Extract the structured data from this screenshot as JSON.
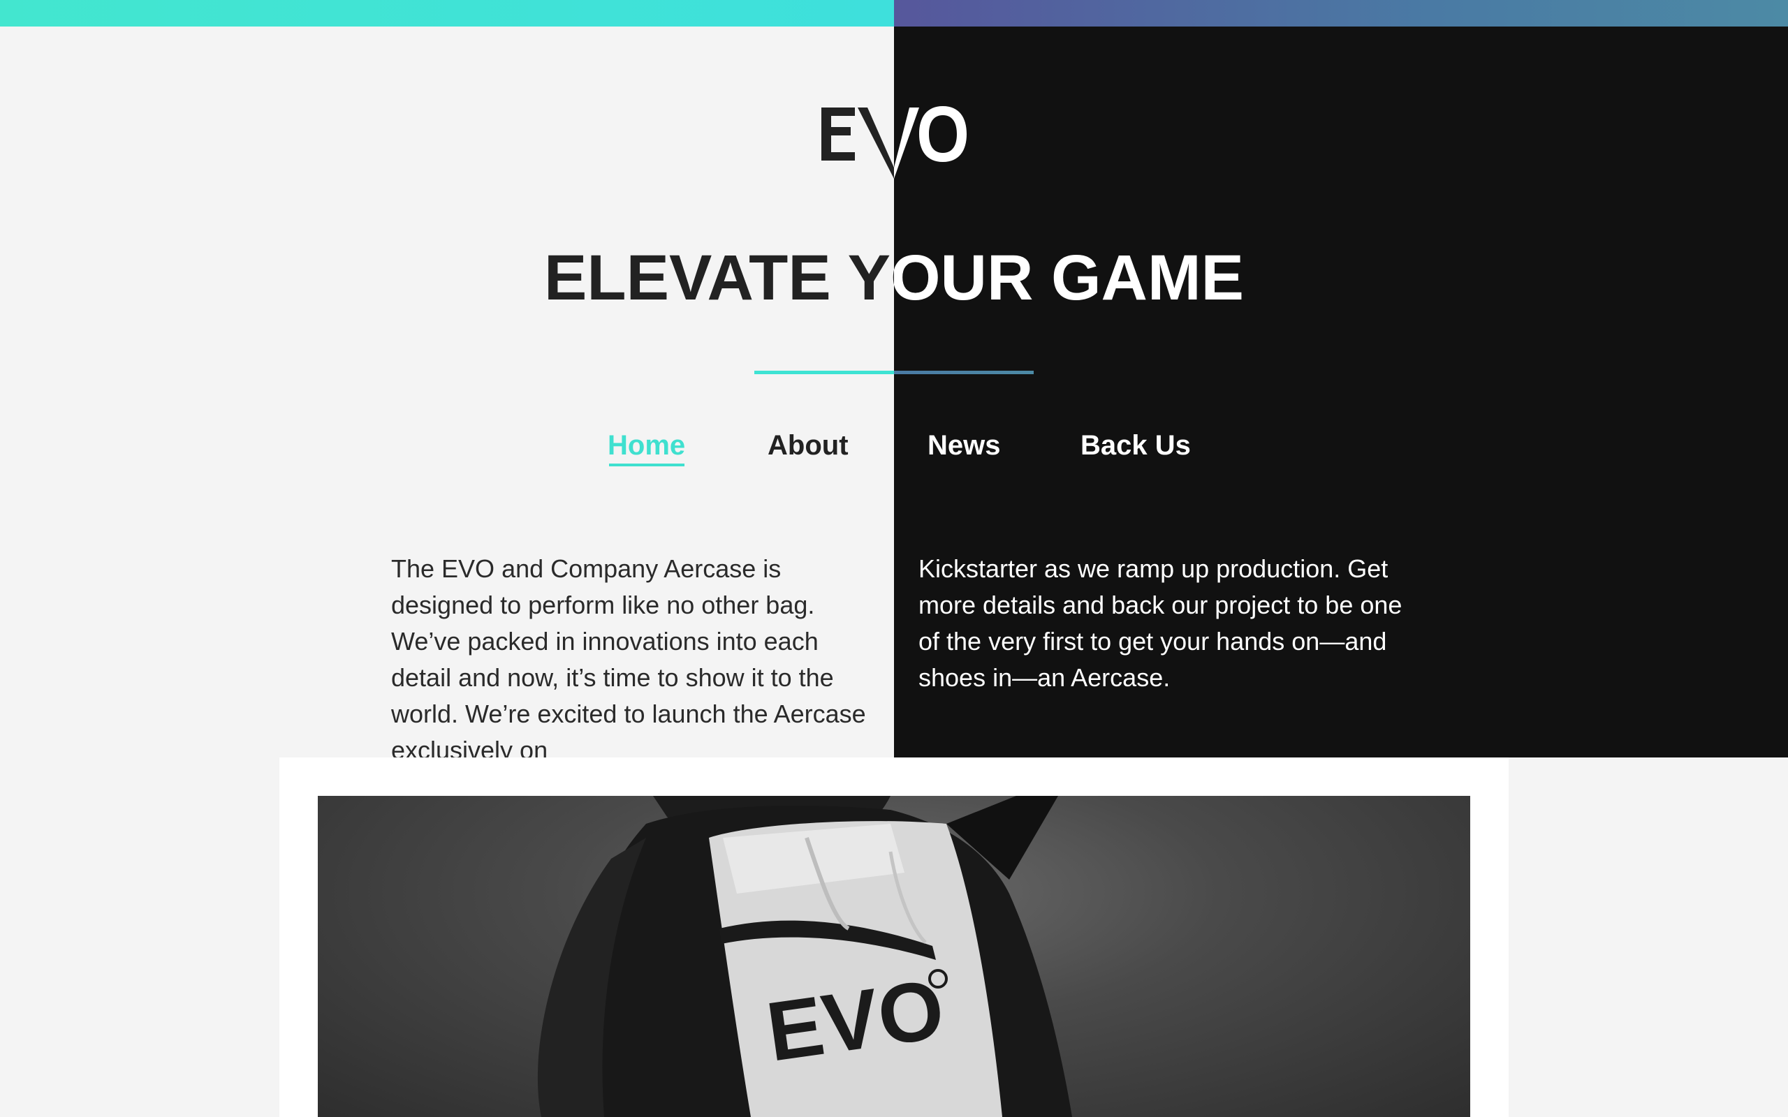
{
  "brand": {
    "logo_text": "EVO"
  },
  "hero": {
    "headline": "ELEVATE YOUR GAME"
  },
  "nav": {
    "items": [
      {
        "label": "Home",
        "active": true
      },
      {
        "label": "About",
        "active": false
      },
      {
        "label": "News",
        "active": false
      },
      {
        "label": "Back Us",
        "active": false
      }
    ]
  },
  "intro": {
    "left_text": "The EVO and Company Aercase is designed to perform like no other bag. We’ve packed in innovations into each detail and now, it’s time to show it to the world. We’re excited to launch the Aercase exclusively on",
    "right_text": "Kickstarter as we ramp up production. Get more details and back our project to be one of the very first to get your hands on—and shoes in—an Aercase."
  },
  "photo": {
    "bag_logo_text": "EVO"
  },
  "colors": {
    "accent_teal": "#3fe0cf",
    "accent_blue": "#4a7aa4",
    "dark_bg": "#111111",
    "light_bg": "#f4f4f4"
  }
}
